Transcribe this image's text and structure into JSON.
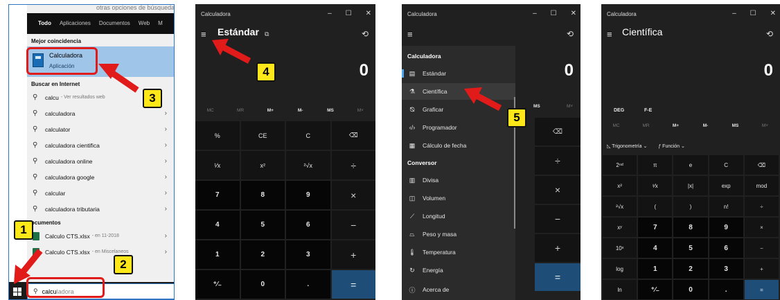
{
  "panel1": {
    "top_fragment": "otras opciones de búsqueda",
    "tabs": [
      "Todo",
      "Aplicaciones",
      "Documentos",
      "Web",
      "M"
    ],
    "best_match_header": "Mejor coincidencia",
    "best_match": {
      "title": "Calculadora",
      "subtitle": "Aplicación"
    },
    "internet_header": "Buscar en Internet",
    "results": [
      {
        "text": "calcu",
        "hint": "- Ver resultados web"
      },
      {
        "text": "calculadora"
      },
      {
        "text": "calculator"
      },
      {
        "text": "calculadora cientifica"
      },
      {
        "text": "calculadora online"
      },
      {
        "text": "calculadora google"
      },
      {
        "text": "calcular"
      },
      {
        "text": "calculadora tributaria"
      }
    ],
    "documents_header": "ocumentos",
    "documents": [
      {
        "text": "Calculo CTS.xlsx",
        "hint": "- en 11-2018"
      },
      {
        "text": "Calculo CTS.xlsx",
        "hint": "- en Miscelaneos"
      }
    ],
    "search_typed": "calcu",
    "search_rest": "ladora"
  },
  "panel2": {
    "title": "Calculadora",
    "mode": "Estándar",
    "display": "0",
    "memory": [
      "MC",
      "MR",
      "M+",
      "M-",
      "MS",
      "M˅"
    ],
    "keys": [
      "%",
      "CE",
      "C",
      "⌫",
      "¹⁄x",
      "x²",
      "²√x",
      "÷",
      "7",
      "8",
      "9",
      "×",
      "4",
      "5",
      "6",
      "−",
      "1",
      "2",
      "3",
      "+",
      "⁺⁄₋",
      "0",
      ".",
      "="
    ]
  },
  "panel3": {
    "title": "Calculadora",
    "display": "0",
    "section_calc": "Calculadora",
    "calc_items": [
      "Estándar",
      "Científica",
      "Graficar",
      "Programador",
      "Cálculo de fecha"
    ],
    "section_conv": "Conversor",
    "conv_items": [
      "Divisa",
      "Volumen",
      "Longitud",
      "Peso y masa",
      "Temperatura",
      "Energía"
    ],
    "about": "Acerca de",
    "visible_keys": [
      "MS",
      "M˅",
      "⌫",
      "÷",
      "×",
      "−",
      "+",
      "="
    ]
  },
  "panel4": {
    "title": "Calculadora",
    "mode": "Científica",
    "display": "0",
    "deg": "DEG",
    "fe": "F-E",
    "memory": [
      "MC",
      "MR",
      "M+",
      "M-",
      "MS",
      "M˅"
    ],
    "trig": "Trigonometría ⌄",
    "func": "Función ⌄",
    "keys": [
      "2ⁿᵈ",
      "π",
      "e",
      "C",
      "⌫",
      "x²",
      "¹⁄x",
      "|x|",
      "exp",
      "mod",
      "²√x",
      "(",
      ")",
      "n!",
      "÷",
      "xʸ",
      "7",
      "8",
      "9",
      "×",
      "10ˣ",
      "4",
      "5",
      "6",
      "−",
      "log",
      "1",
      "2",
      "3",
      "+",
      "ln",
      "⁺⁄₋",
      "0",
      ".",
      "="
    ]
  },
  "badges": [
    "1",
    "2",
    "3",
    "4",
    "5"
  ],
  "colors": {
    "accent_arrow": "#e11a1a",
    "badge": "#ffe81a",
    "equals_key": "#1e4d78",
    "calc_bg": "#202020"
  }
}
